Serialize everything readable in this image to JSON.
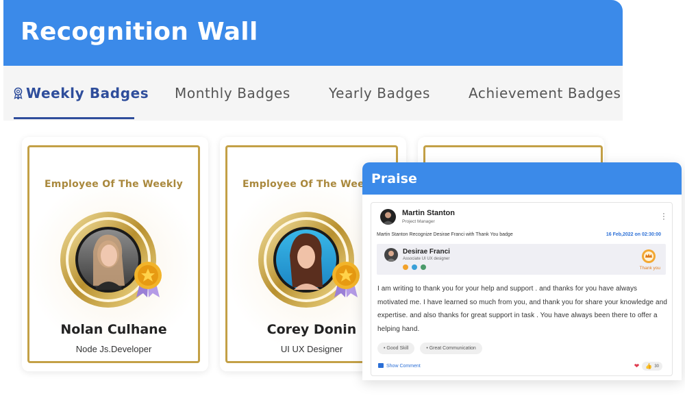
{
  "header": {
    "title": "Recognition Wall"
  },
  "tabs": [
    {
      "label": "Weekly Badges",
      "active": true
    },
    {
      "label": "Monthly Badges",
      "active": false
    },
    {
      "label": "Yearly Badges",
      "active": false
    },
    {
      "label": "Achievement Badges",
      "active": false
    }
  ],
  "badge_cards": [
    {
      "label": "Employee Of The Weekly",
      "name": "Nolan Culhane",
      "role": "Node Js.Developer"
    },
    {
      "label": "Employee Of The Weekly",
      "name": "Corey Donin",
      "role": "UI UX Designer"
    }
  ],
  "praise": {
    "title": "Praise",
    "post": {
      "author_name": "Martin Stanton",
      "author_title": "Project Manager",
      "recognize_text": "Martin Stanton Recognize Desirae Franci with Thank You badge",
      "timestamp": "16 Feb,2022 on 02:30:00",
      "recipient_name": "Desirae Franci",
      "recipient_title": "Associate UI UX designer",
      "badge_label": "Thank you",
      "message": "I am writing to thank you for your help and support . and thanks for you have always motivated me. I have learned so much from you, and thank you for share your knowledge and expertise. and also thanks for great support in task . You have always been there to offer a helping hand.",
      "tags": [
        "• Good Skill",
        "• Great Communication"
      ],
      "show_comment_label": "Show Comment",
      "reaction_count": "30"
    }
  },
  "colors": {
    "brand": "#3b8ae9",
    "tab_active": "#2e4d9b",
    "gold": "#c3a046",
    "timestamp": "#2b6fd6"
  }
}
